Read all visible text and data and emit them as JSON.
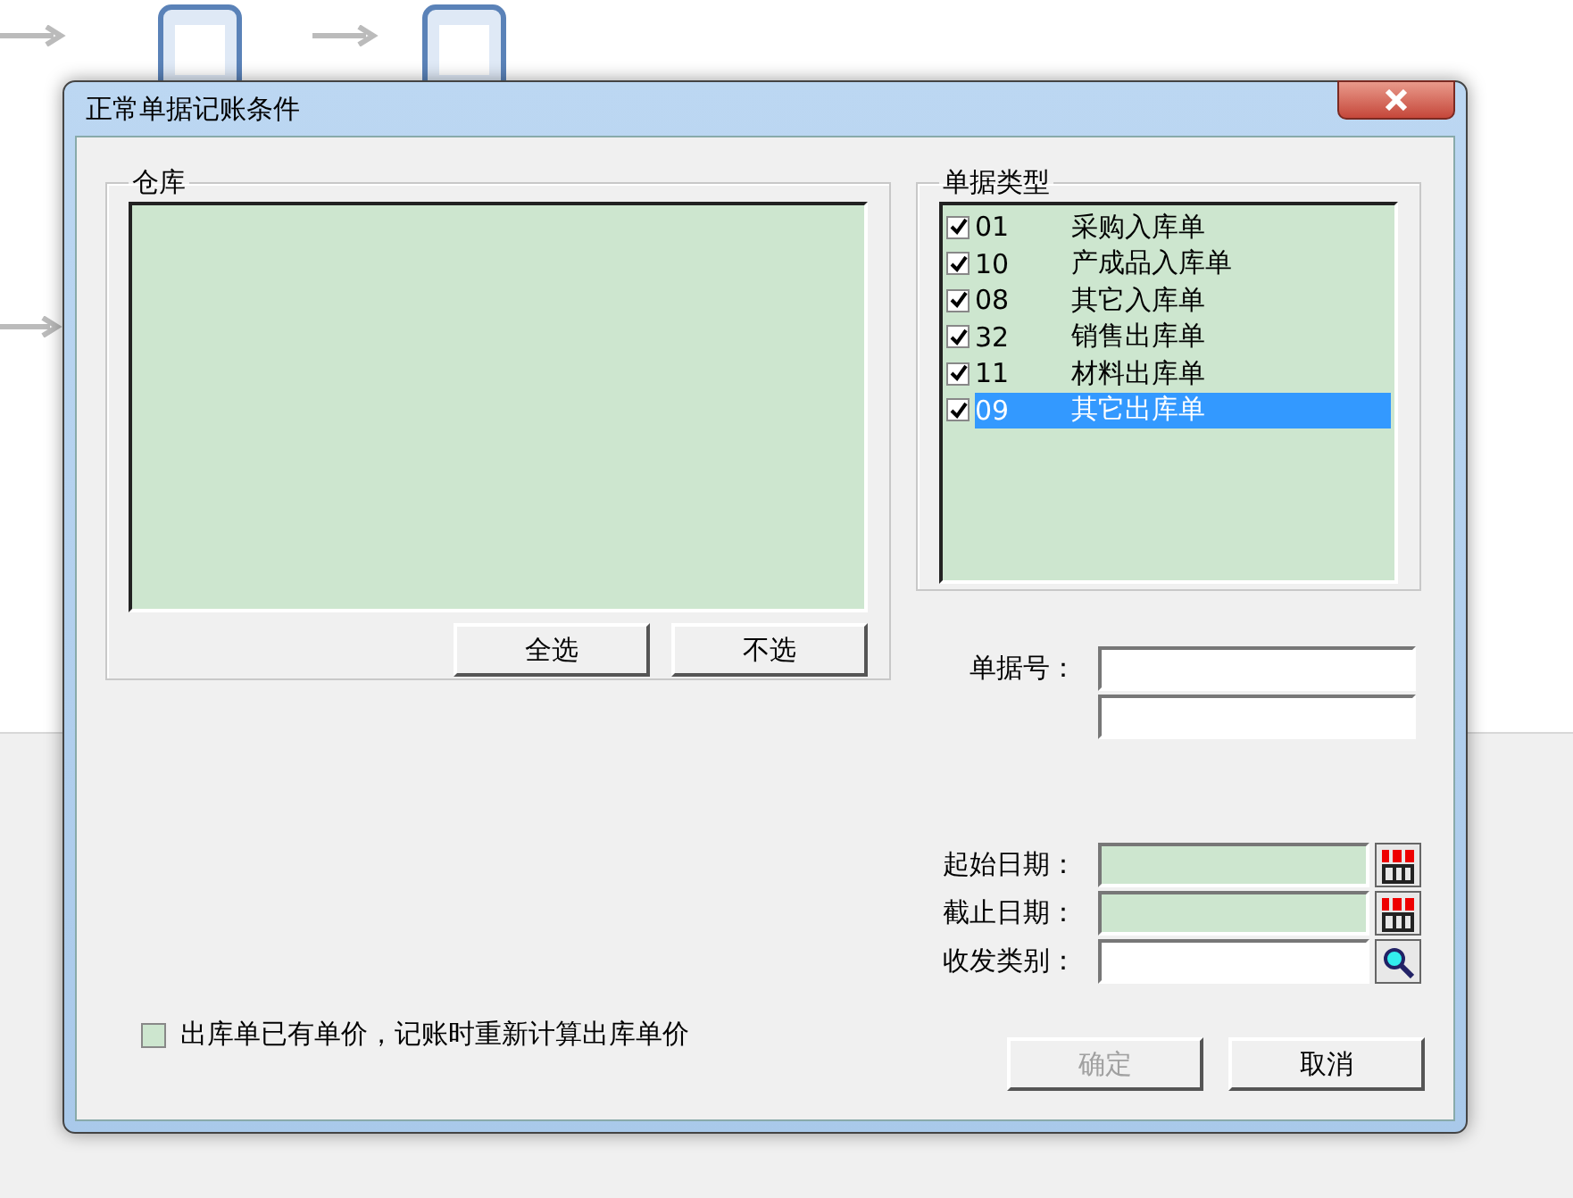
{
  "window": {
    "title": "正常单据记账条件"
  },
  "warehouse": {
    "label": "仓库",
    "buttons": [
      "全选",
      "不选"
    ]
  },
  "doc_types": {
    "label": "单据类型",
    "items": [
      {
        "code": "01",
        "name": "采购入库单",
        "checked": true,
        "selected": false
      },
      {
        "code": "10",
        "name": "产成品入库单",
        "checked": true,
        "selected": false
      },
      {
        "code": "08",
        "name": "其它入库单",
        "checked": true,
        "selected": false
      },
      {
        "code": "32",
        "name": "销售出库单",
        "checked": true,
        "selected": false
      },
      {
        "code": "11",
        "name": "材料出库单",
        "checked": true,
        "selected": false
      },
      {
        "code": "09",
        "name": "其它出库单",
        "checked": true,
        "selected": true
      }
    ]
  },
  "doc_number": {
    "label": "单据号："
  },
  "fields": [
    {
      "label": "起始日期：",
      "kind": "date"
    },
    {
      "label": "截止日期：",
      "kind": "date"
    },
    {
      "label": "收发类别：",
      "kind": "lookup"
    }
  ],
  "option": {
    "label": "出库单已有单价，记账时重新计算出库单价",
    "checked": false
  },
  "buttons": [
    {
      "label": "确定",
      "disabled": true
    },
    {
      "label": "取消",
      "disabled": false
    }
  ]
}
